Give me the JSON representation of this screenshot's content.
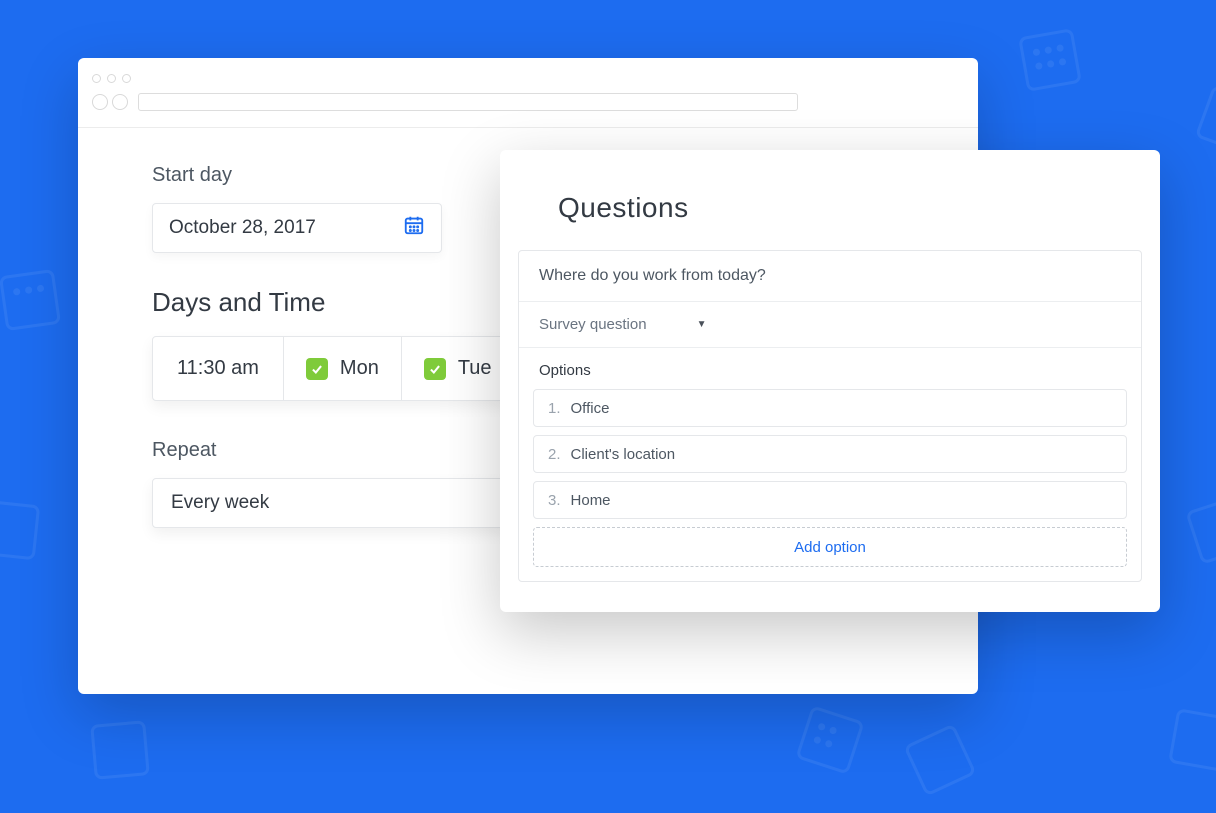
{
  "schedule": {
    "start_day_label": "Start day",
    "start_day_value": "October 28, 2017",
    "days_time_title": "Days and Time",
    "time_value": "11:30 am",
    "days": [
      {
        "label": "Mon",
        "checked": true
      },
      {
        "label": "Tue",
        "checked": true
      }
    ],
    "repeat_label": "Repeat",
    "repeat_value": "Every week"
  },
  "questions": {
    "title": "Questions",
    "question_text": "Where do you work from today?",
    "type_label": "Survey question",
    "options_label": "Options",
    "options": [
      {
        "num": "1.",
        "text": "Office"
      },
      {
        "num": "2.",
        "text": "Client's location"
      },
      {
        "num": "3.",
        "text": "Home"
      }
    ],
    "add_option_label": "Add option"
  },
  "colors": {
    "accent": "#1d6cf0",
    "success": "#7fcb3a"
  }
}
